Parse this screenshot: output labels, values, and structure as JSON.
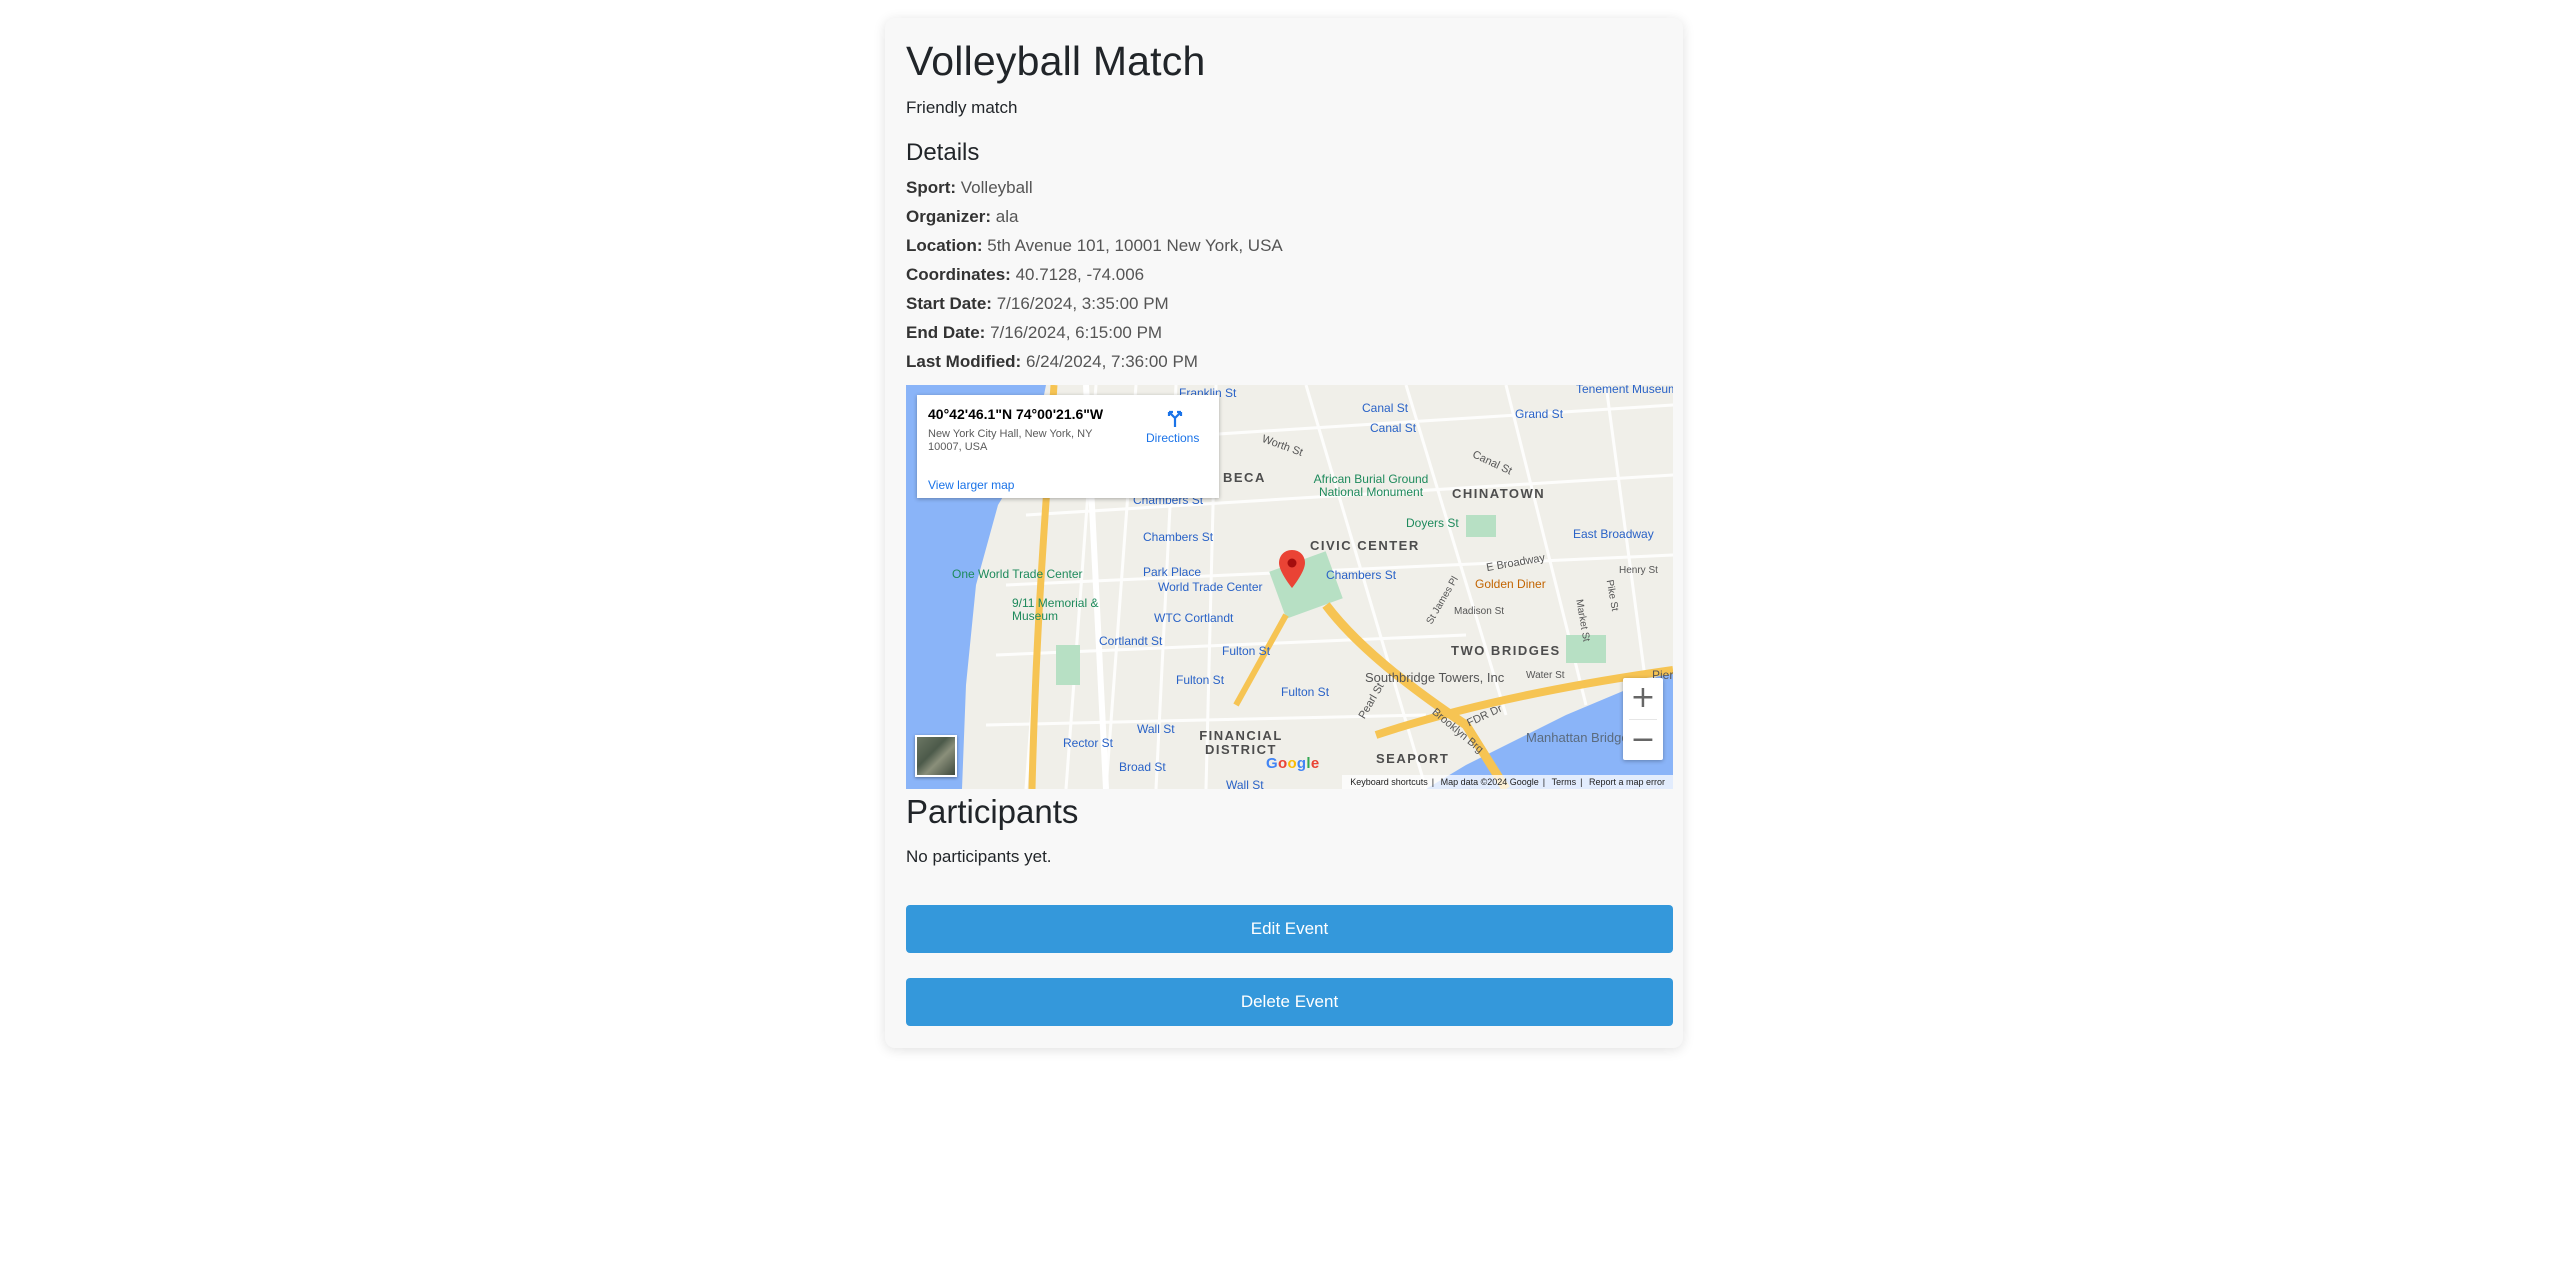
{
  "event": {
    "title": "Volleyball Match",
    "description": "Friendly match"
  },
  "details": {
    "heading": "Details",
    "rows": [
      {
        "label": "Sport:",
        "value": "Volleyball"
      },
      {
        "label": "Organizer:",
        "value": "ala"
      },
      {
        "label": "Location:",
        "value": "5th Avenue 101, 10001 New York, USA"
      },
      {
        "label": "Coordinates:",
        "value": "40.7128, -74.006"
      },
      {
        "label": "Start Date:",
        "value": "7/16/2024, 3:35:00 PM"
      },
      {
        "label": "End Date:",
        "value": "7/16/2024, 6:15:00 PM"
      },
      {
        "label": "Last Modified:",
        "value": "6/24/2024, 7:36:00 PM"
      }
    ]
  },
  "map": {
    "infobox": {
      "coords": "40°42'46.1\"N 74°00'21.6\"W",
      "address": "New York City Hall, New York, NY 10007, USA",
      "directions": "Directions",
      "view_larger": "View larger map"
    },
    "zoom_in": "+",
    "zoom_out": "−",
    "logo": "Google",
    "attribution": [
      "Keyboard shortcuts",
      "Map data ©2024 Google",
      "Terms",
      "Report a map error"
    ],
    "labels": {
      "franklin_st": "Franklin St",
      "tenement": "Tenement Museum",
      "canal_st_1": "Canal St",
      "canal_st_2": "Canal St",
      "grand_st": "Grand St",
      "worth_st": "Worth St",
      "canal_st_road": "Canal St",
      "african_burial": "African Burial Ground National Monument",
      "chinatown": "CHINATOWN",
      "tribeca": "BECA",
      "chambers_st_1": "Chambers St",
      "chambers_st_2": "Chambers St",
      "chambers_st_3": "Chambers St",
      "doyers_st": "Doyers St",
      "east_broadway": "East Broadway",
      "civic_center": "CIVIC CENTER",
      "park_place": "Park Place",
      "wtc": "World Trade Center",
      "one_wtc": "One World Trade Center",
      "memorial": "9/11 Memorial & Museum",
      "wtc_cortlandt": "WTC Cortlandt",
      "cortlandt_st": "Cortlandt St",
      "golden_diner": "Golden Diner",
      "e_broadway": "E Broadway",
      "two_bridges": "TWO BRIDGES",
      "fulton_st_1": "Fulton St",
      "fulton_st_2": "Fulton St",
      "fulton_st_3": "Fulton St",
      "southbridge": "Southbridge Towers, Inc",
      "wall_st": "Wall St",
      "rector_st": "Rector St",
      "broad_st": "Broad St",
      "wall_st_2": "Wall St",
      "financial": "FINANCIAL DISTRICT",
      "seaport": "SEAPORT",
      "manhattan_bridge": "Manhattan Bridge",
      "pier": "Pier",
      "fdr": "FDR Dr",
      "brooklyn_brg": "Brooklyn Brg",
      "henry_st": "Henry St",
      "pike_st": "Pike St",
      "madison_st": "Madison St",
      "water_st": "Water St",
      "pearl_st": "Pearl St",
      "st_james": "St James Pl",
      "market_st": "Market St"
    }
  },
  "participants": {
    "heading": "Participants",
    "empty_text": "No participants yet."
  },
  "actions": {
    "edit": "Edit Event",
    "delete": "Delete Event"
  },
  "colors": {
    "button": "#3498db",
    "water": "#8ab4f8",
    "park": "#b7e0c4",
    "highway": "#f6c453",
    "marker": "#ea4335"
  }
}
